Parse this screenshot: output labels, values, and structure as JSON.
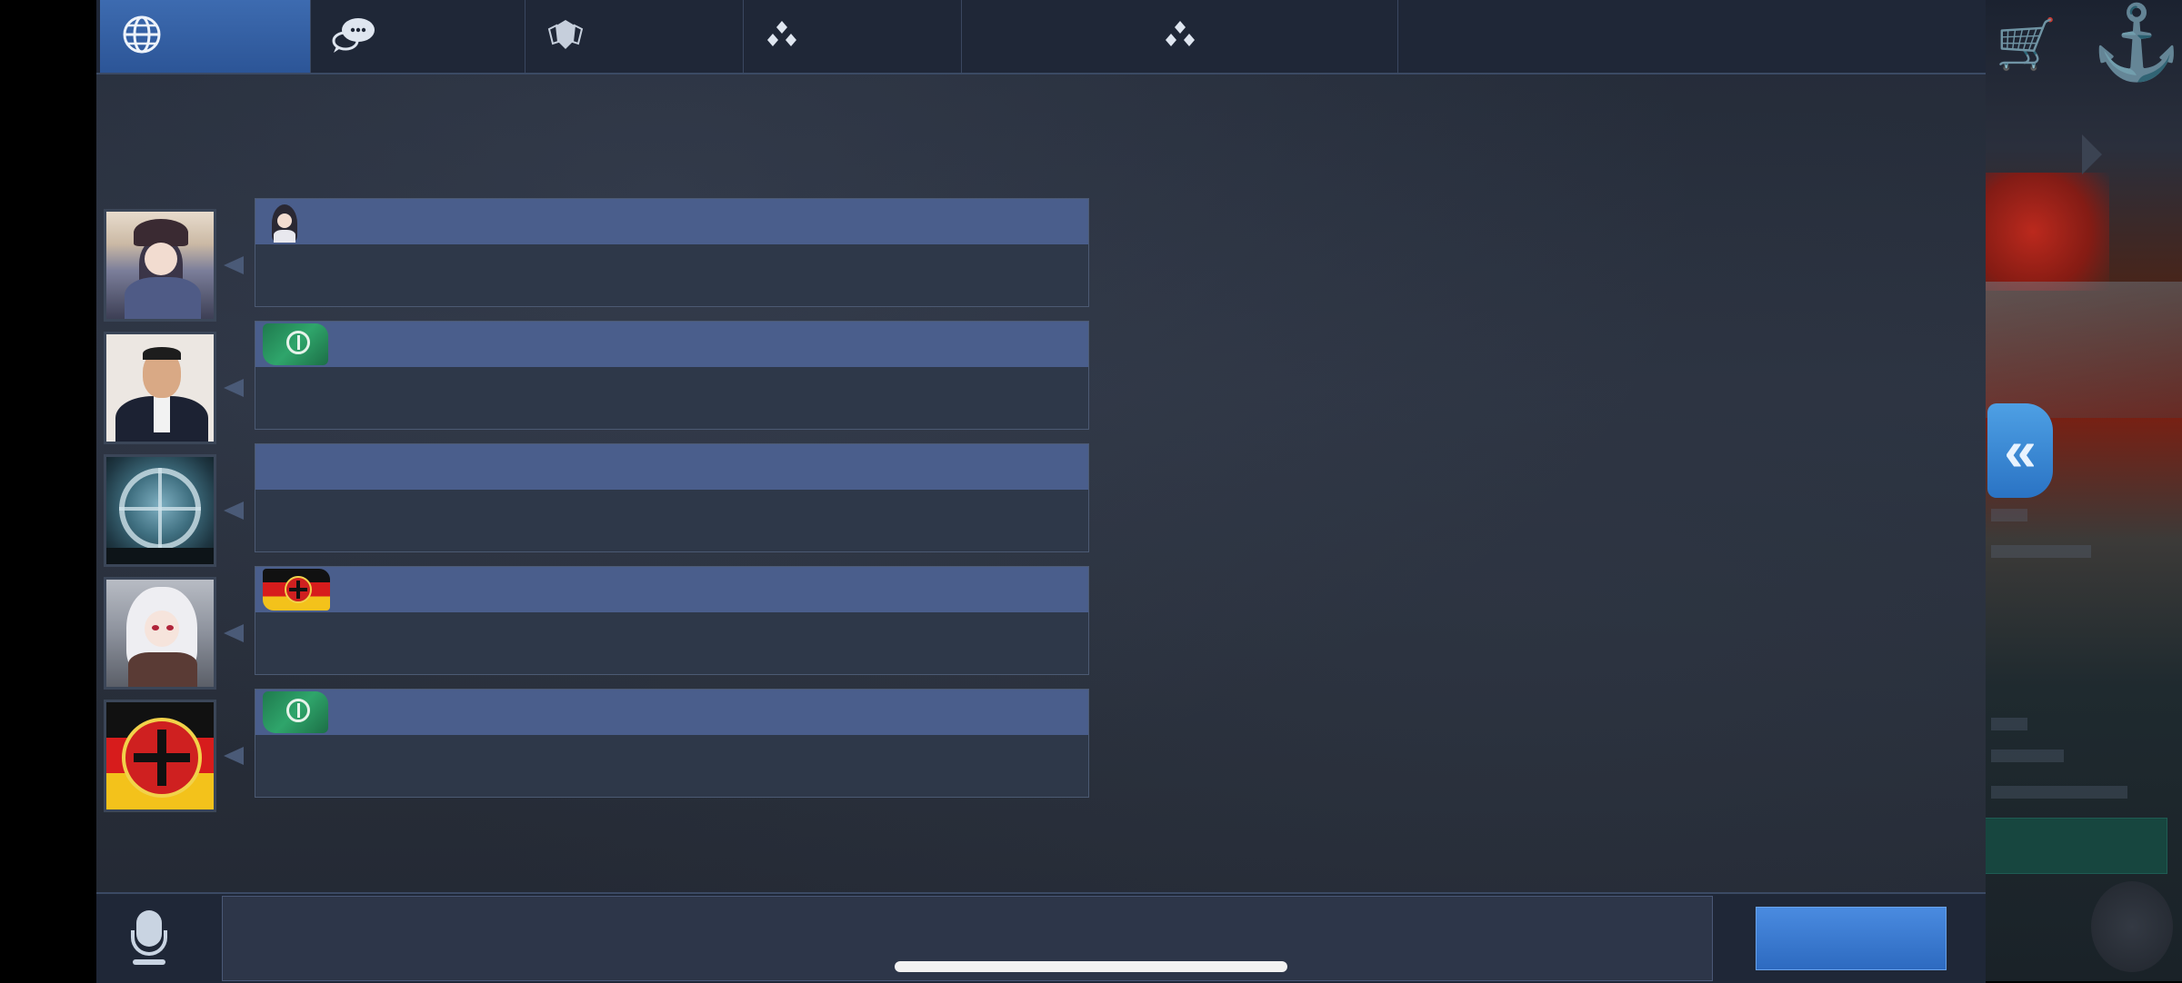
{
  "tabs": [
    {
      "id": "world",
      "icon": "globe-icon",
      "active": true
    },
    {
      "id": "chat",
      "icon": "speech-bubbles-icon",
      "active": false
    },
    {
      "id": "guild",
      "icon": "shield-badge-icon",
      "active": false
    },
    {
      "id": "group1",
      "icon": "three-dots-cluster-icon",
      "active": false
    },
    {
      "id": "group2",
      "icon": "three-dots-cluster-icon",
      "active": false
    },
    {
      "id": "empty",
      "icon": "",
      "active": false
    }
  ],
  "messages": [
    {
      "avatar": "anime-witch-avatar",
      "badge": "anime-character-badge",
      "name": "",
      "text": ""
    },
    {
      "avatar": "man-in-suit-avatar",
      "badge": "green-emblem-flag-badge",
      "name": "",
      "text": ""
    },
    {
      "avatar": "crosshair-scope-avatar",
      "badge": "",
      "name": "",
      "text": ""
    },
    {
      "avatar": "white-hair-anime-avatar",
      "badge": "german-iron-cross-flag-badge",
      "name": "",
      "text": ""
    },
    {
      "avatar": "iron-cross-flag-avatar",
      "badge": "green-emblem-flag-badge",
      "name": "",
      "text": ""
    }
  ],
  "bottom": {
    "input_value": "",
    "input_placeholder": "",
    "send_label": ""
  },
  "side": {
    "collapse_label": "«"
  }
}
